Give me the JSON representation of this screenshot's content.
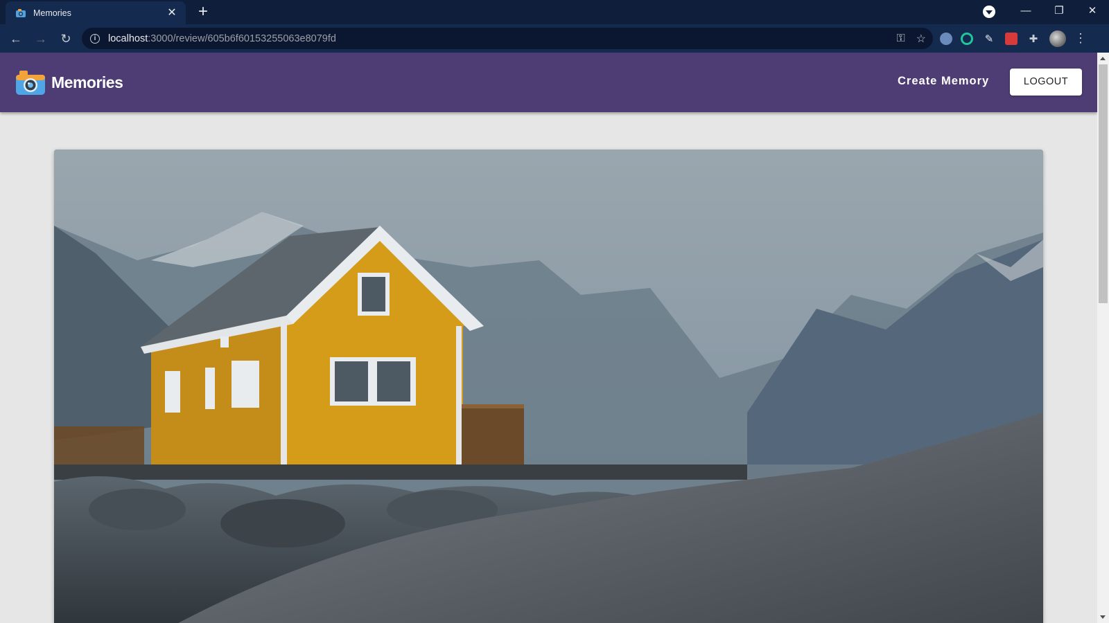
{
  "browser": {
    "tab_title": "Memories",
    "url_host": "localhost",
    "url_path": ":3000/review/605b6f60153255063e8079fd"
  },
  "app": {
    "brand": "Memories",
    "nav": {
      "create_label": "Create Memory",
      "logout_label": "LOGOUT"
    }
  },
  "memory": {
    "image_alt": "Yellow wooden house near misty mountains and rocky shore"
  },
  "colors": {
    "header_bg": "#4d3d74",
    "page_bg": "#e6e6e6",
    "browser_frame": "#0f1e3a"
  }
}
